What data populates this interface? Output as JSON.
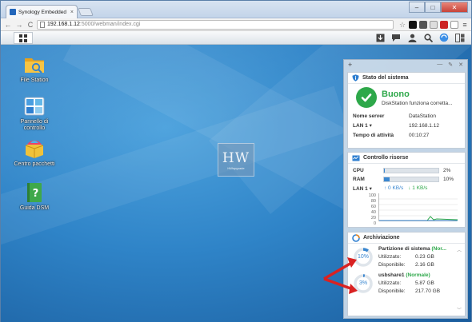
{
  "browser": {
    "tab_title": "Synology Embedded Data",
    "tab_close": "×",
    "url_host": "192.168.1.12",
    "url_path": ":5000/webman/index.cgi",
    "back": "←",
    "forward": "→",
    "reload": "C",
    "controls": {
      "minimize": "–",
      "maximize": "□",
      "close": "✕"
    },
    "menu_icon": "≡",
    "star_icon": "☆"
  },
  "desktop": {
    "watermark_logo": "HW",
    "watermark_sub": "HWupgrade",
    "shortcuts": [
      {
        "label": "File Station",
        "icon": "folder-icon"
      },
      {
        "label": "Pannello di controllo",
        "icon": "control-panel-icon"
      },
      {
        "label": "Centro pacchetti",
        "icon": "package-center-icon"
      },
      {
        "label": "Guida DSM",
        "icon": "help-icon"
      }
    ]
  },
  "widgets": {
    "add_label": "+",
    "system_health": {
      "title": "Stato del sistema",
      "status": "Buono",
      "description": "DiskStation funziona corretta...",
      "rows": [
        {
          "key": "Nome server",
          "value": "DataStation"
        },
        {
          "key": "LAN 1 ▾",
          "value": "192.168.1.12"
        },
        {
          "key": "Tempo di attività",
          "value": "00:10:27"
        }
      ]
    },
    "resource_monitor": {
      "title": "Controllo risorse",
      "cpu_label": "CPU",
      "cpu_percent": 2,
      "cpu_text": "2%",
      "ram_label": "RAM",
      "ram_percent": 10,
      "ram_text": "10%",
      "lan_label": "LAN 1 ▾",
      "upload": "↑ 0 KB/s",
      "download": "↓ 1 KB/s",
      "y_ticks": [
        "100",
        "80",
        "60",
        "40",
        "20",
        "0"
      ],
      "colors": {
        "upload": "#3a87d0",
        "download": "#2ea84a"
      }
    },
    "storage": {
      "title": "Archiviazione",
      "volumes": [
        {
          "name": "Partizione di sistema",
          "state": "(Nor...",
          "percent": 10,
          "percent_text": "10%",
          "used_label": "Utilizzato:",
          "used": "0.23 GB",
          "free_label": "Disponibile:",
          "free": "2.16 GB"
        },
        {
          "name": "usbshare1",
          "state": "(Normale)",
          "percent": 3,
          "percent_text": "3%",
          "used_label": "Utilizzato:",
          "used": "5.87 GB",
          "free_label": "Disponibile:",
          "free": "217.70 GB"
        }
      ]
    }
  }
}
